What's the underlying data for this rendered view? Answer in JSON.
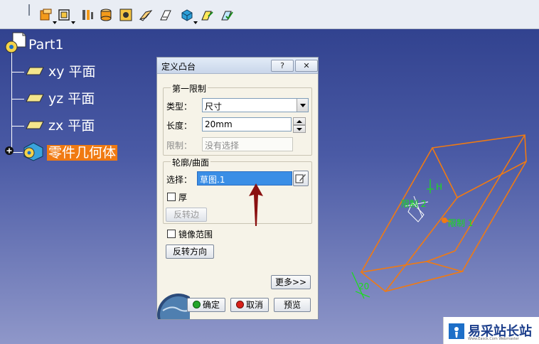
{
  "toolbar": {
    "buttons": [
      "pad-icon",
      "sketch-icon",
      "shaft-icon",
      "hole-icon",
      "pocket-icon",
      "rib-icon",
      "slot-icon",
      "solid-combine-icon",
      "multi-pad-icon",
      "draft-icon"
    ]
  },
  "tree": {
    "root": "Part1",
    "items": [
      {
        "label": "xy 平面"
      },
      {
        "label": "yz 平面"
      },
      {
        "label": "zx 平面"
      },
      {
        "label": "零件几何体"
      }
    ]
  },
  "dialog": {
    "title": "定义凸台",
    "help_label": "?",
    "close_label": "✕",
    "first_limit": {
      "legend": "第一限制",
      "type_label": "类型：",
      "type_value": "尺寸",
      "length_label": "长度：",
      "length_value": "20mm",
      "limit_label": "限制：",
      "limit_value": "没有选择"
    },
    "profile": {
      "legend": "轮廓/曲面",
      "select_label": "选择：",
      "select_value": "草图.1",
      "thick_label": "厚",
      "reverse_side_label": "反转边"
    },
    "mirror_label": "镜像范围",
    "reverse_dir_label": "反转方向",
    "more_label": "更多>>",
    "ok_label": "确定",
    "cancel_label": "取消",
    "preview_label": "预览"
  },
  "viewport": {
    "limit2_label": "限制 2",
    "limit1_label": "限制 1",
    "h_label": "H",
    "dim_value": "20"
  },
  "watermark": {
    "text": "易采站长站",
    "sub": "Www.Easck.Com Webmaster"
  },
  "colors": {
    "accent_orange": "#f07a12",
    "selection_blue": "#3a8ee6",
    "dim_green": "#18e018",
    "arrow_red": "#8a1010"
  }
}
